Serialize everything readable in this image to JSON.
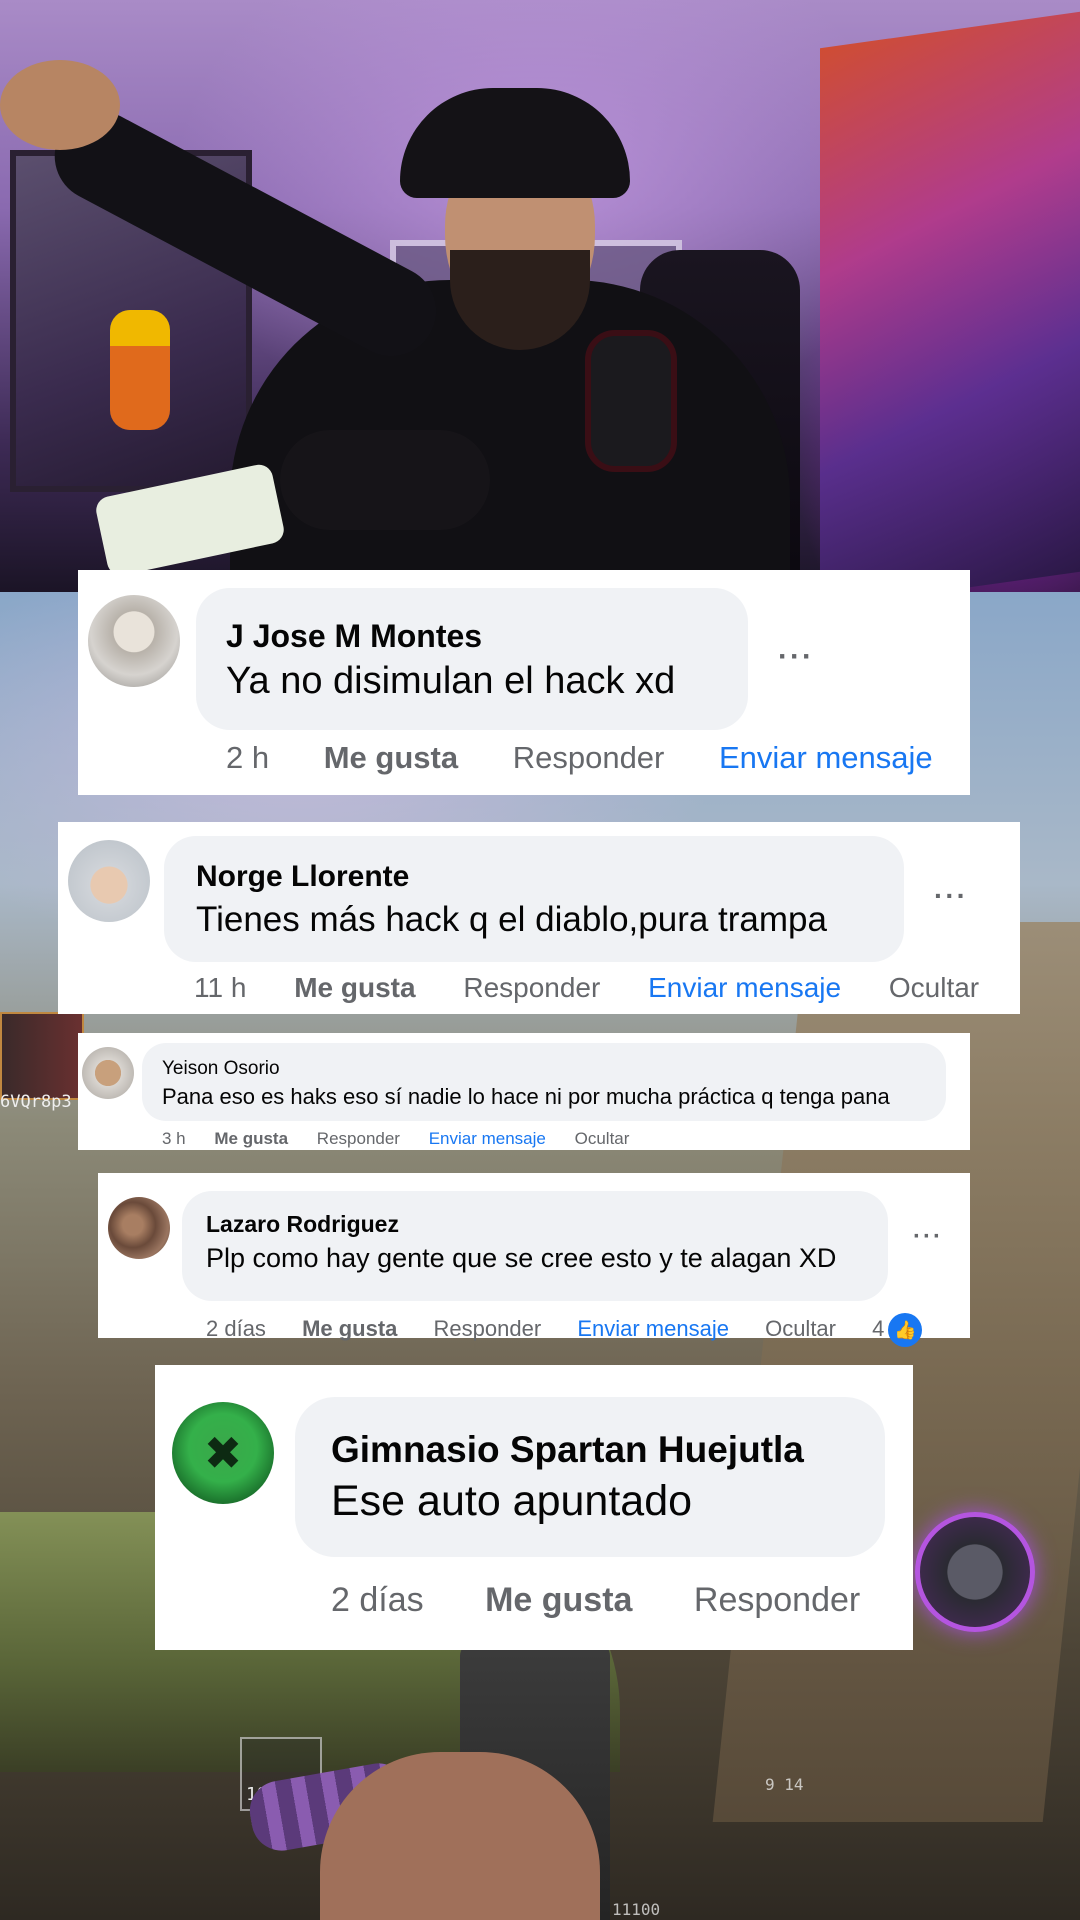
{
  "background": {
    "hud_number": "18",
    "hud_left_label": "6VQr8p3",
    "hud_right_stats": "9  14",
    "hud_bottom": "11100"
  },
  "comments": [
    {
      "author": "J Jose M Montes",
      "text": "Ya no disimulan el hack xd",
      "time": "2 h",
      "like": "Me gusta",
      "reply": "Responder",
      "message": "Enviar mensaje",
      "more": "···"
    },
    {
      "author": "Norge Llorente",
      "text": "Tienes más hack q el diablo,pura trampa",
      "time": "11 h",
      "like": "Me gusta",
      "reply": "Responder",
      "message": "Enviar mensaje",
      "hide": "Ocultar",
      "more": "···"
    },
    {
      "author": "Yeison Osorio",
      "text": "Pana eso es haks eso sí nadie lo hace ni por mucha práctica q tenga pana",
      "time": "3 h",
      "like": "Me gusta",
      "reply": "Responder",
      "message": "Enviar mensaje",
      "hide": "Ocultar"
    },
    {
      "author": "Lazaro Rodriguez",
      "text": "Plp como hay gente que se cree esto y te alagan XD",
      "time": "2 días",
      "like": "Me gusta",
      "reply": "Responder",
      "message": "Enviar mensaje",
      "hide": "Ocultar",
      "reaction_count": "4",
      "more": "···"
    },
    {
      "author": "Gimnasio Spartan Huejutla",
      "text": "Ese auto apuntado",
      "time": "2 días",
      "like": "Me gusta",
      "reply": "Responder"
    }
  ],
  "colors": {
    "link": "#1877f2",
    "bubble": "#f0f2f5",
    "meta": "#65676b",
    "text": "#050505"
  }
}
